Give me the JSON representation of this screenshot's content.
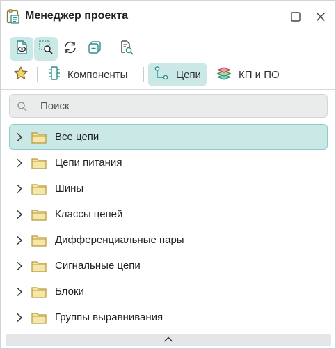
{
  "window": {
    "title": "Менеджер проекта"
  },
  "toolbar": {
    "buttons": [
      {
        "name": "document-view",
        "icon": "document-eye-icon",
        "active": true
      },
      {
        "name": "selection-find",
        "icon": "selection-search-icon",
        "active": true
      },
      {
        "name": "refresh",
        "icon": "refresh-icon",
        "active": false
      },
      {
        "name": "collapse",
        "icon": "collapse-icon",
        "active": false
      },
      {
        "name": "find-in-document",
        "icon": "document-search-icon",
        "active": false
      }
    ]
  },
  "tabs": [
    {
      "label": "",
      "icon": "star-icon",
      "active": false
    },
    {
      "label": "Компоненты",
      "icon": "component-icon",
      "active": false
    },
    {
      "label": "Цепи",
      "icon": "net-icon",
      "active": true
    },
    {
      "label": "КП и ПО",
      "icon": "layers-icon",
      "active": false
    }
  ],
  "search": {
    "placeholder": "Поиск",
    "value": ""
  },
  "tree": {
    "items": [
      {
        "label": "Все цепи",
        "selected": true
      },
      {
        "label": "Цепи питания",
        "selected": false
      },
      {
        "label": "Шины",
        "selected": false
      },
      {
        "label": "Классы цепей",
        "selected": false
      },
      {
        "label": "Дифференциальные пары",
        "selected": false
      },
      {
        "label": "Сигнальные цепи",
        "selected": false
      },
      {
        "label": "Блоки",
        "selected": false
      },
      {
        "label": "Группы выравнивания",
        "selected": false
      }
    ]
  },
  "colors": {
    "accent": "#c9e8e6",
    "accent_border": "#8ccfca",
    "icon_teal": "#2a8f88",
    "folder_fill": "#f6e7a8",
    "folder_stroke": "#b59a3c"
  }
}
